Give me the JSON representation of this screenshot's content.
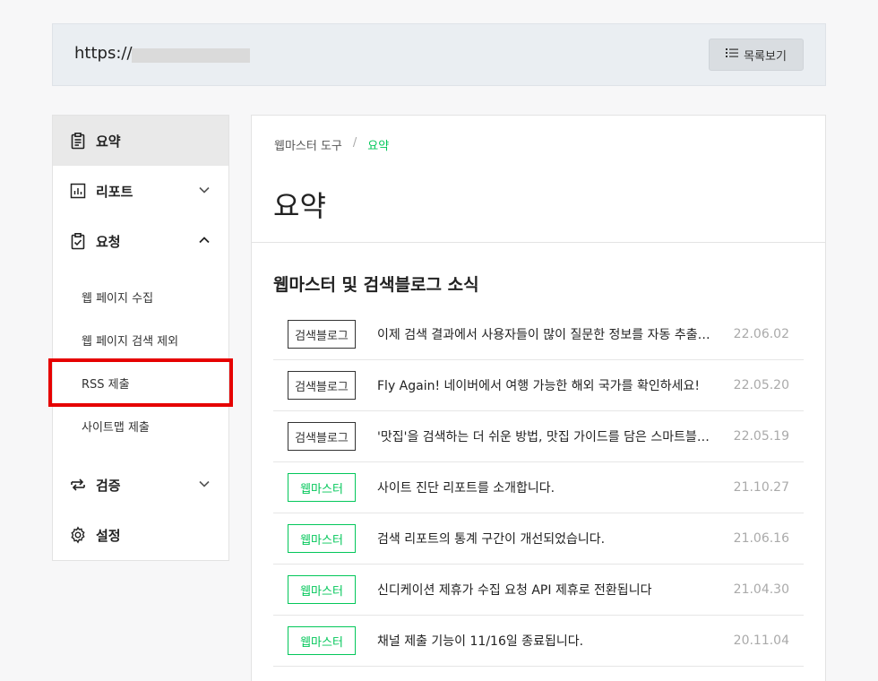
{
  "urlbar": {
    "prefix": "https://",
    "list_button_label": "목록보기"
  },
  "sidebar": {
    "items": [
      {
        "label": "요약",
        "icon": "clipboard-icon"
      },
      {
        "label": "리포트",
        "icon": "chart-icon"
      },
      {
        "label": "요청",
        "icon": "checklist-icon"
      },
      {
        "label": "검증",
        "icon": "swap-icon"
      },
      {
        "label": "설정",
        "icon": "gear-icon"
      }
    ],
    "sub_items": [
      {
        "label": "웹 페이지 수집"
      },
      {
        "label": "웹 페이지 검색 제외"
      },
      {
        "label": "RSS 제출"
      },
      {
        "label": "사이트맵 제출"
      }
    ]
  },
  "breadcrumb": {
    "parent": "웹마스터 도구",
    "separator": "/",
    "current": "요약"
  },
  "main": {
    "title": "요약",
    "section_title": "웹마스터 및 검색블로그 소식"
  },
  "news": [
    {
      "tag": "검색블로그",
      "title": "이제 검색 결과에서 사용자들이 많이 질문한 정보를 자동 추출…",
      "date": "22.06.02"
    },
    {
      "tag": "검색블로그",
      "title": "Fly Again! 네이버에서 여행 가능한 해외 국가를 확인하세요!",
      "date": "22.05.20"
    },
    {
      "tag": "검색블로그",
      "title": "'맛집'을 검색하는 더 쉬운 방법, 맛집 가이드를 담은 스마트블…",
      "date": "22.05.19"
    },
    {
      "tag": "웹마스터",
      "title": "사이트 진단 리포트를 소개합니다.",
      "date": "21.10.27"
    },
    {
      "tag": "웹마스터",
      "title": "검색 리포트의 통계 구간이 개선되었습니다.",
      "date": "21.06.16"
    },
    {
      "tag": "웹마스터",
      "title": "신디케이션 제휴가 수집 요청 API 제휴로 전환됩니다",
      "date": "21.04.30"
    },
    {
      "tag": "웹마스터",
      "title": "채널 제출 기능이 11/16일 종료됩니다.",
      "date": "20.11.04"
    }
  ],
  "colors": {
    "accent_green": "#03c75a",
    "highlight_red": "#e60000"
  }
}
